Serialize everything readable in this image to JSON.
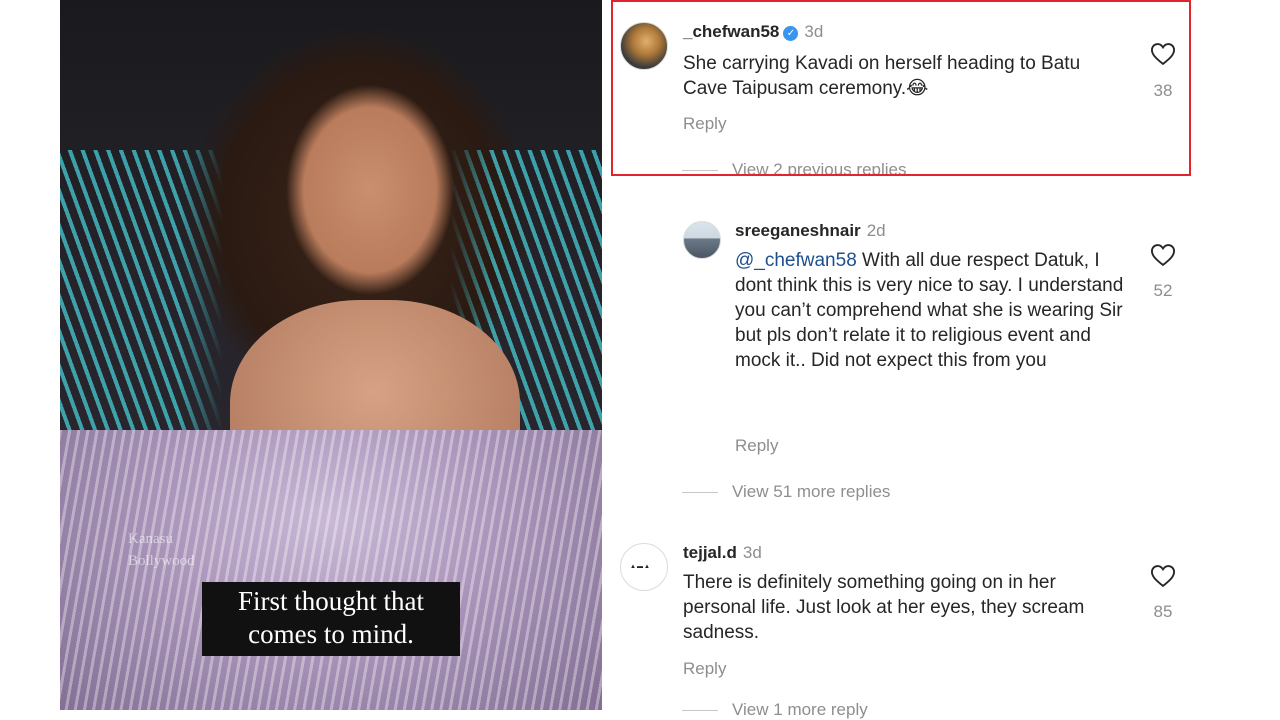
{
  "photo": {
    "caption_line1": "First thought that",
    "caption_line2": "comes to mind.",
    "watermark": "Kanasu Bollywood"
  },
  "comments": [
    {
      "username": "_chefwan58",
      "verified": true,
      "time": "3d",
      "text": "She carrying Kavadi on herself heading to Batu Cave Taipusam ceremony.😂",
      "reply_label": "Reply",
      "likes": "38",
      "view_replies": "View 2 previous replies"
    },
    {
      "username": "sreeganeshnair",
      "time": "2d",
      "mention": "@_chefwan58",
      "text": " With all due respect Datuk, I dont think this is very nice to say. I understand you can’t comprehend what she is wearing Sir but pls don’t relate it to religious event and mock it.. Did not expect this from you",
      "reply_label": "Reply",
      "likes": "52",
      "view_replies": "View 51 more replies"
    },
    {
      "username": "tejjal.d",
      "time": "3d",
      "text": "There is definitely something going on in her personal life. Just look at her eyes, they scream sadness.",
      "reply_label": "Reply",
      "likes": "85",
      "view_replies": "View 1 more reply"
    }
  ],
  "colors": {
    "highlight_border": "#e0252e",
    "mention": "#1d4f8f",
    "verified_badge": "#3797f0",
    "muted_text": "#8e8e8e"
  },
  "icons": {
    "like": "heart-outline-icon",
    "verified": "verified-badge-icon"
  }
}
